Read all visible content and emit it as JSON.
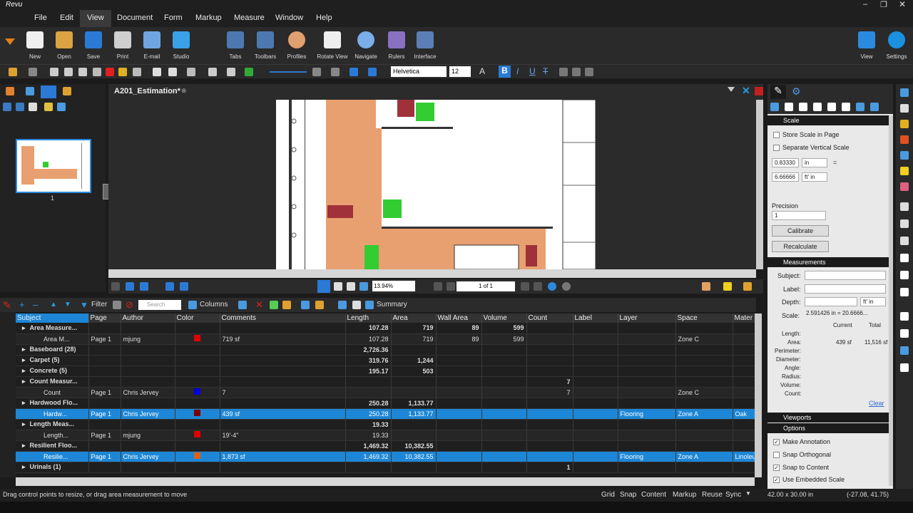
{
  "app": {
    "logo": "Revu"
  },
  "menu": [
    "File",
    "Edit",
    "View",
    "Document",
    "Form",
    "Markup",
    "Measure",
    "Window",
    "Help"
  ],
  "ribbon": [
    {
      "label": "New",
      "icon": "new-doc-icon"
    },
    {
      "label": "Open",
      "icon": "folder-icon"
    },
    {
      "label": "Save",
      "icon": "save-icon"
    },
    {
      "label": "Print",
      "icon": "print-icon"
    },
    {
      "label": "E-mail",
      "icon": "email-icon"
    },
    {
      "label": "Studio",
      "icon": "studio-icon"
    },
    {
      "label": "Tabs",
      "icon": "tabs-icon"
    },
    {
      "label": "Toolbars",
      "icon": "toolbars-icon"
    },
    {
      "label": "Profiles",
      "icon": "profiles-icon"
    },
    {
      "label": "Rotate View",
      "icon": "rotate-icon"
    },
    {
      "label": "Navigate",
      "icon": "navigate-icon"
    },
    {
      "label": "Rulers",
      "icon": "rulers-icon"
    },
    {
      "label": "Interface",
      "icon": "interface-icon"
    },
    {
      "label": "View",
      "icon": "view-icon"
    },
    {
      "label": "Settings",
      "icon": "settings-icon"
    }
  ],
  "font": {
    "family": "Helvetica",
    "size": "12"
  },
  "doc_tab": "A201_Estimation*",
  "thumb_page": "1",
  "nav": {
    "zoom": "13.94%",
    "page": "1 of 1"
  },
  "list_toolbar": {
    "filter": "Filter",
    "search": "Search",
    "columns": "Columns",
    "summary": "Summary"
  },
  "columns": [
    "Subject",
    "Page",
    "Author",
    "Color",
    "Comments",
    "Length",
    "Area",
    "Wall Area",
    "Volume",
    "Count",
    "Label",
    "Layer",
    "Space",
    "Mater"
  ],
  "rows": [
    {
      "type": "group",
      "subject": "Area Measure...",
      "page": "",
      "author": "",
      "color": "",
      "comments": "",
      "length": "107.28",
      "area": "719",
      "wall": "89",
      "volume": "599",
      "count": "",
      "label": "",
      "layer": "",
      "space": "",
      "mat": ""
    },
    {
      "type": "child",
      "subject": "Area M...",
      "page": "Page 1",
      "author": "mjung",
      "color": "#e00000",
      "comments": "719 sf",
      "length": "107.28",
      "area": "719",
      "wall": "89",
      "volume": "599",
      "count": "",
      "label": "",
      "layer": "",
      "space": "Zone C",
      "mat": ""
    },
    {
      "type": "group",
      "subject": "Baseboard (28)",
      "page": "",
      "author": "",
      "color": "",
      "comments": "",
      "length": "2,726.36",
      "area": "",
      "wall": "",
      "volume": "",
      "count": "",
      "label": "",
      "layer": "",
      "space": "",
      "mat": ""
    },
    {
      "type": "group",
      "subject": "Carpet (5)",
      "page": "",
      "author": "",
      "color": "",
      "comments": "",
      "length": "319.76",
      "area": "1,244",
      "wall": "",
      "volume": "",
      "count": "",
      "label": "",
      "layer": "",
      "space": "",
      "mat": ""
    },
    {
      "type": "group",
      "subject": "Concrete (5)",
      "page": "",
      "author": "",
      "color": "",
      "comments": "",
      "length": "195.17",
      "area": "503",
      "wall": "",
      "volume": "",
      "count": "",
      "label": "",
      "layer": "",
      "space": "",
      "mat": ""
    },
    {
      "type": "group",
      "subject": "Count Measur...",
      "page": "",
      "author": "",
      "color": "",
      "comments": "",
      "length": "",
      "area": "",
      "wall": "",
      "volume": "",
      "count": "7",
      "label": "",
      "layer": "",
      "space": "",
      "mat": ""
    },
    {
      "type": "child",
      "subject": "Count",
      "page": "Page 1",
      "author": "Chris Jervey",
      "color": "#0000e0",
      "comments": "7",
      "length": "",
      "area": "",
      "wall": "",
      "volume": "",
      "count": "7",
      "label": "",
      "layer": "",
      "space": "Zone C",
      "mat": ""
    },
    {
      "type": "group",
      "subject": "Hardwood Flo...",
      "page": "",
      "author": "",
      "color": "",
      "comments": "",
      "length": "250.28",
      "area": "1,133.77",
      "wall": "",
      "volume": "",
      "count": "",
      "label": "",
      "layer": "",
      "space": "",
      "mat": ""
    },
    {
      "type": "sel",
      "subject": "Hardw...",
      "page": "Page 1",
      "author": "Chris Jervey",
      "color": "#7a0000",
      "comments": "439 sf",
      "length": "250.28",
      "area": "1,133.77",
      "wall": "",
      "volume": "",
      "count": "",
      "label": "",
      "layer": "Flooring",
      "space": "Zone A",
      "mat": "Oak"
    },
    {
      "type": "group",
      "subject": "Length Meas...",
      "page": "",
      "author": "",
      "color": "",
      "comments": "",
      "length": "19.33",
      "area": "",
      "wall": "",
      "volume": "",
      "count": "",
      "label": "",
      "layer": "",
      "space": "",
      "mat": ""
    },
    {
      "type": "child",
      "subject": "Length...",
      "page": "Page 1",
      "author": "mjung",
      "color": "#e00000",
      "comments": "19'-4\"",
      "length": "19.33",
      "area": "",
      "wall": "",
      "volume": "",
      "count": "",
      "label": "",
      "layer": "",
      "space": "",
      "mat": ""
    },
    {
      "type": "group",
      "subject": "Resilient Floo...",
      "page": "",
      "author": "",
      "color": "",
      "comments": "",
      "length": "1,469.32",
      "area": "10,382.55",
      "wall": "",
      "volume": "",
      "count": "",
      "label": "",
      "layer": "",
      "space": "",
      "mat": ""
    },
    {
      "type": "sel",
      "subject": "Resilie...",
      "page": "Page 1",
      "author": "Chris Jervey",
      "color": "#e06010",
      "comments": "1,873 sf",
      "length": "1,469.32",
      "area": "10,382.55",
      "wall": "",
      "volume": "",
      "count": "",
      "label": "",
      "layer": "Flooring",
      "space": "Zone A",
      "mat": "Linoleu"
    },
    {
      "type": "group",
      "subject": "Urinals (1)",
      "page": "",
      "author": "",
      "color": "",
      "comments": "",
      "length": "",
      "area": "",
      "wall": "",
      "volume": "",
      "count": "1",
      "label": "",
      "layer": "",
      "space": "",
      "mat": ""
    }
  ],
  "right": {
    "scale_hdr": "Scale",
    "store_scale": "Store Scale in Page",
    "sep_vert": "Separate Vertical Scale",
    "scale1": "0.83330",
    "unit1": "in",
    "eq": "=",
    "scale2": "6.66666",
    "unit2": "ft' in",
    "precision_lbl": "Precision",
    "precision": "1",
    "calibrate": "Calibrate",
    "recalculate": "Recalculate",
    "meas_hdr": "Measurements",
    "subject_lbl": "Subject:",
    "label_lbl": "Label:",
    "depth_lbl": "Depth:",
    "depth_unit": "ft' in",
    "scale_lbl": "Scale:",
    "scale_val": "2.591426 in = 20.6666...",
    "current": "Current",
    "total": "Total",
    "length_lbl": "Length:",
    "area_lbl": "Area:",
    "area_cur": "439 sf",
    "area_tot": "11,516 sf",
    "perimeter_lbl": "Perimeter:",
    "diameter_lbl": "Diameter:",
    "angle_lbl": "Angle:",
    "radius_lbl": "Radius:",
    "volume_lbl": "Volume:",
    "count_lbl": "Count:",
    "clear": "Clear",
    "viewports_hdr": "Viewports",
    "options_hdr": "Options",
    "make_annot": "Make Annotation",
    "snap_ortho": "Snap Orthogonal",
    "snap_content": "Snap to Content",
    "embedded_scale": "Use Embedded Scale"
  },
  "status": {
    "message": "Drag control points to resize, or drag area measurement to move",
    "items": [
      "Grid",
      "Snap",
      "Content",
      "Markup",
      "Reuse",
      "Sync"
    ],
    "size": "42.00 x 30.00 in",
    "coords": "(-27.08, 41.75)"
  }
}
